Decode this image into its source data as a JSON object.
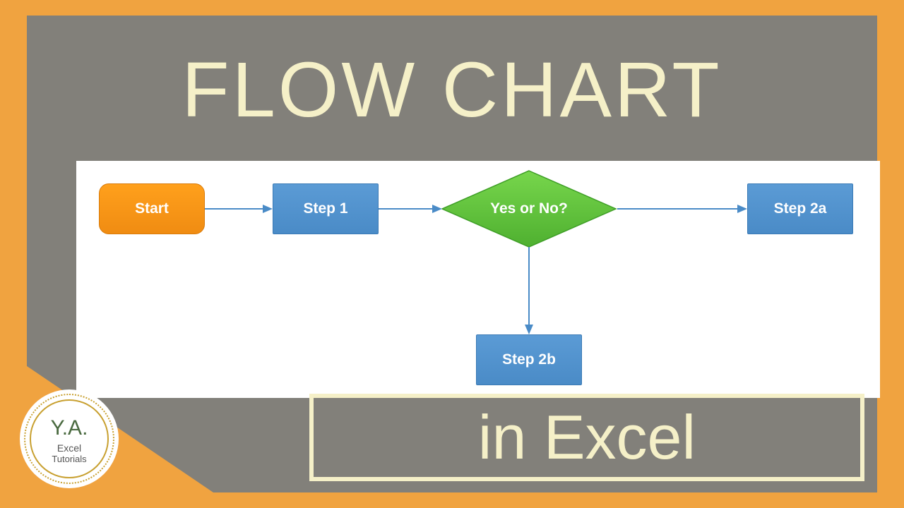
{
  "title": "FLOW CHART",
  "subtitle": "in Excel",
  "flow": {
    "start": "Start",
    "step1": "Step 1",
    "decision": "Yes or No?",
    "step2a": "Step 2a",
    "step2b": "Step 2b"
  },
  "logo": {
    "initials": "Y.A.",
    "line1": "Excel",
    "line2": "Tutorials"
  },
  "chart_data": {
    "type": "flowchart",
    "nodes": [
      {
        "id": "start",
        "label": "Start",
        "shape": "terminator",
        "fill": "#f08c12"
      },
      {
        "id": "step1",
        "label": "Step 1",
        "shape": "process",
        "fill": "#4a8bc7"
      },
      {
        "id": "decision",
        "label": "Yes or No?",
        "shape": "decision",
        "fill": "#5bbf3a"
      },
      {
        "id": "step2a",
        "label": "Step 2a",
        "shape": "process",
        "fill": "#4a8bc7"
      },
      {
        "id": "step2b",
        "label": "Step 2b",
        "shape": "process",
        "fill": "#4a8bc7"
      }
    ],
    "edges": [
      {
        "from": "start",
        "to": "step1"
      },
      {
        "from": "step1",
        "to": "decision"
      },
      {
        "from": "decision",
        "to": "step2a"
      },
      {
        "from": "decision",
        "to": "step2b"
      }
    ]
  }
}
